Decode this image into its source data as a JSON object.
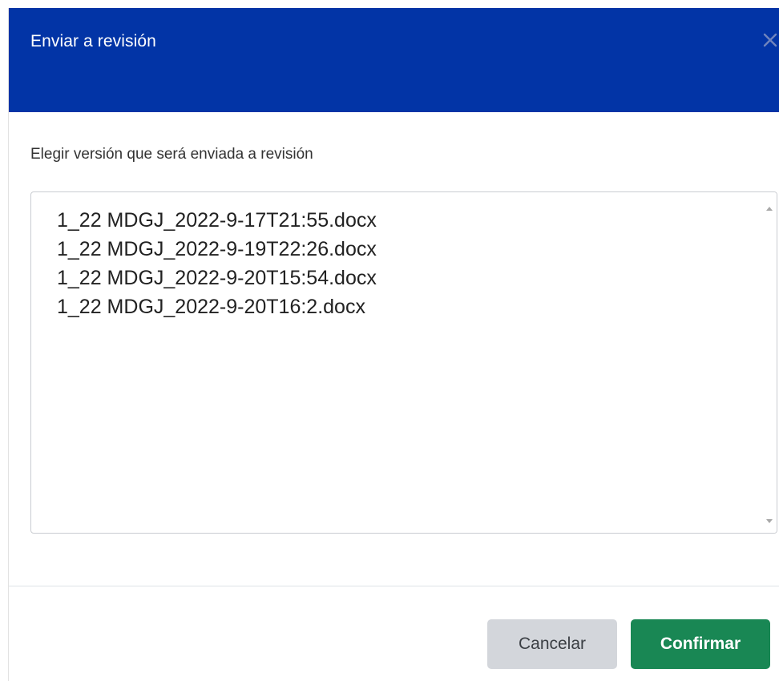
{
  "modal": {
    "title": "Enviar a revisión",
    "close_icon": "close-icon",
    "prompt": "Elegir versión que será enviada a revisión",
    "versions": [
      "1_22 MDGJ_2022-9-17T21:55.docx",
      "1_22 MDGJ_2022-9-19T22:26.docx",
      "1_22 MDGJ_2022-9-20T15:54.docx",
      "1_22 MDGJ_2022-9-20T16:2.docx"
    ],
    "cancel_label": "Cancelar",
    "confirm_label": "Confirmar"
  },
  "colors": {
    "header": "#0234a6",
    "confirm": "#198754",
    "cancel": "#d3d6db"
  }
}
